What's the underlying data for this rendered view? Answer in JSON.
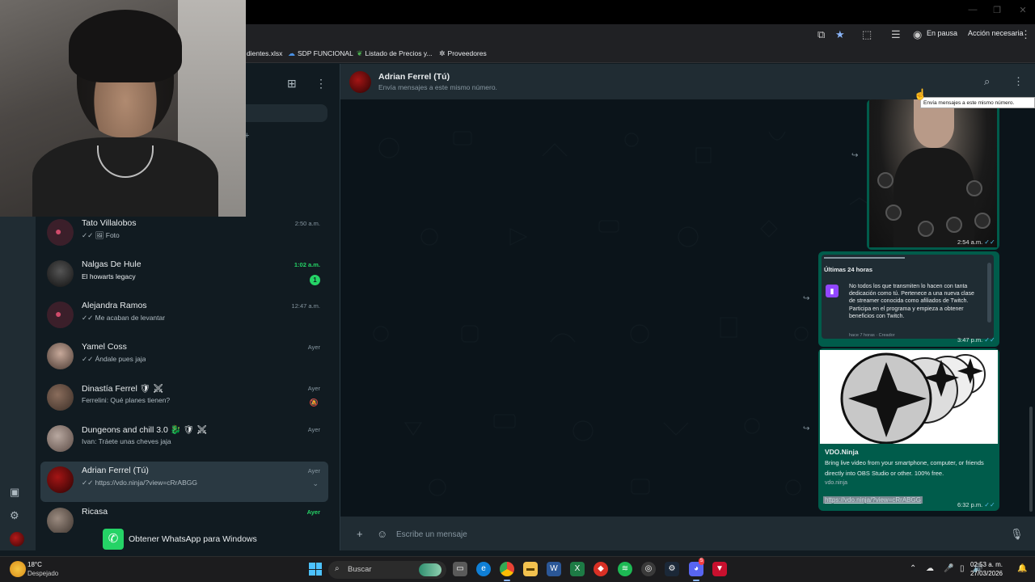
{
  "browser": {
    "profile_status": "En pausa",
    "action_label": "Acción necesaria",
    "bookmarks": [
      {
        "label": "dientes.xlsx",
        "icon": "excel-icon"
      },
      {
        "label": "SDP FUNCIONAL",
        "icon": "onedrive-icon"
      },
      {
        "label": "Listado de Precios y...",
        "icon": "leaf-icon"
      },
      {
        "label": "Proveedores",
        "icon": "sparkle-icon"
      }
    ]
  },
  "chats": [
    {
      "name": "Tato Villalobos",
      "last": "✓✓ 🖼 Foto",
      "time": "2:50 a.m.",
      "time_green": false,
      "badge": "",
      "avatar": "default"
    },
    {
      "name": "Nalgas De Hule",
      "last": "El howarts legacy",
      "time": "1:02 a.m.",
      "time_green": true,
      "badge": "1",
      "avatar": "photo"
    },
    {
      "name": "Alejandra Ramos",
      "last": "✓✓ Me acaban de levantar",
      "time": "12:47 a.m.",
      "time_green": false,
      "badge": "",
      "avatar": "default"
    },
    {
      "name": "Yamel  Coss",
      "last": "✓✓ Ándale pues jaja",
      "time": "Ayer",
      "time_green": false,
      "badge": "",
      "avatar": "photo"
    },
    {
      "name": "Dinastía Ferrel 🛡 ⚔",
      "last": "Ferrelini: Qué planes tienen?",
      "time": "Ayer",
      "time_green": false,
      "badge": "",
      "avatar": "group"
    },
    {
      "name": "Dungeons and chill 3.0 🐉 🛡 ⚔",
      "last": "Ivan: Tráete unas cheves jaja",
      "time": "Ayer",
      "time_green": false,
      "badge": "",
      "avatar": "group"
    },
    {
      "name": "Adrian Ferrel (Tú)",
      "last": "✓✓ https://vdo.ninja/?view=cRrABGG",
      "time": "Ayer",
      "time_green": false,
      "badge": "",
      "avatar": "red"
    },
    {
      "name": "Ricasa",
      "last": "",
      "time": "Ayer",
      "time_green": true,
      "badge": "",
      "avatar": "photo"
    }
  ],
  "get_app_label": "Obtener WhatsApp para Windows",
  "conversation": {
    "name": "Adrian Ferrel (Tú)",
    "subtitle": "Envía mensajes a este mismo número.",
    "tooltip": "Envía mensajes a este mismo número.",
    "msg1_time": "2:54 a.m.",
    "twitch": {
      "heading": "Últimas 24 horas",
      "body": "No todos los que transmiten lo hacen con tanta dedicación como tú. Pertenece a una nueva clase de streamer conocida como afiliados de Twitch. Participa en el programa y empieza a obtener beneficios con Twitch.",
      "meta": "hace 7 horas · Creador",
      "time": "3:47 p.m."
    },
    "vdo": {
      "title": "VDO.Ninja",
      "description": "Bring live video from your smartphone, computer, or friends directly into OBS Studio or other. 100% free.",
      "host": "vdo.ninja",
      "link": "https://vdo.ninja/?view=cRrABGG",
      "time": "6:32 p.m."
    },
    "compose_placeholder": "Escribe un mensaje"
  },
  "taskbar": {
    "temperature": "18°C",
    "condition": "Despejado",
    "search": "Buscar",
    "time": "02:53 a. m.",
    "date": "27/03/2026",
    "notification_count": "5"
  },
  "colors": {
    "accent": "#25d366",
    "bubble": "#005c4b",
    "panel": "#202c33",
    "background": "#0b141a"
  }
}
